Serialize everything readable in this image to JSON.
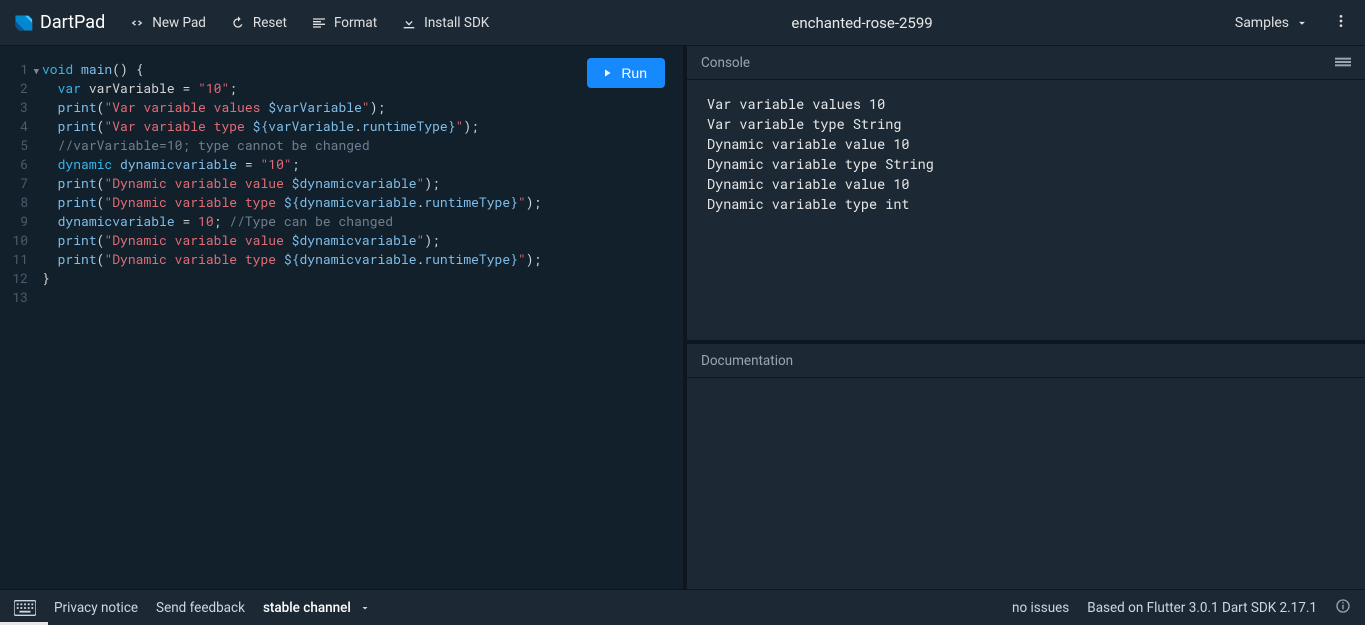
{
  "header": {
    "app_name": "DartPad",
    "project_title": "enchanted-rose-2599",
    "buttons": {
      "new_pad": "New Pad",
      "reset": "Reset",
      "format": "Format",
      "install_sdk": "Install SDK",
      "samples": "Samples",
      "run": "Run"
    }
  },
  "editor": {
    "line_count": 13,
    "fold_line": 1,
    "code_lines": [
      [
        [
          "kw",
          "void"
        ],
        [
          "pun",
          " "
        ],
        [
          "fn",
          "main"
        ],
        [
          "pun",
          "() {"
        ]
      ],
      [
        [
          "pun",
          "  "
        ],
        [
          "kw",
          "var"
        ],
        [
          "pun",
          " "
        ],
        [
          "id",
          "varVariable"
        ],
        [
          "pun",
          " = "
        ],
        [
          "str",
          "\"10\""
        ],
        [
          "pun",
          ";"
        ]
      ],
      [
        [
          "pun",
          "  "
        ],
        [
          "fn",
          "print"
        ],
        [
          "pun",
          "("
        ],
        [
          "str",
          "\"Var variable values "
        ],
        [
          "interp",
          "$varVariable"
        ],
        [
          "str",
          "\""
        ],
        [
          "pun",
          ");"
        ]
      ],
      [
        [
          "pun",
          "  "
        ],
        [
          "fn",
          "print"
        ],
        [
          "pun",
          "("
        ],
        [
          "str",
          "\"Var variable type "
        ],
        [
          "interp",
          "${"
        ],
        [
          "prop",
          "varVariable"
        ],
        [
          "pun",
          "."
        ],
        [
          "prop",
          "runtimeType"
        ],
        [
          "interp",
          "}"
        ],
        [
          "str",
          "\""
        ],
        [
          "pun",
          ");"
        ]
      ],
      [
        [
          "pun",
          "  "
        ],
        [
          "cmt",
          "//varVariable=10; type cannot be changed"
        ]
      ],
      [
        [
          "pun",
          "  "
        ],
        [
          "kw",
          "dynamic"
        ],
        [
          "pun",
          " "
        ],
        [
          "prop",
          "dynamicvariable"
        ],
        [
          "pun",
          " = "
        ],
        [
          "str",
          "\"10\""
        ],
        [
          "pun",
          ";"
        ]
      ],
      [
        [
          "pun",
          "  "
        ],
        [
          "fn",
          "print"
        ],
        [
          "pun",
          "("
        ],
        [
          "str",
          "\"Dynamic variable value "
        ],
        [
          "interp",
          "$dynamicvariable"
        ],
        [
          "str",
          "\""
        ],
        [
          "pun",
          ");"
        ]
      ],
      [
        [
          "pun",
          "  "
        ],
        [
          "fn",
          "print"
        ],
        [
          "pun",
          "("
        ],
        [
          "str",
          "\"Dynamic variable type "
        ],
        [
          "interp",
          "${"
        ],
        [
          "prop",
          "dynamicvariable"
        ],
        [
          "pun",
          "."
        ],
        [
          "prop",
          "runtimeType"
        ],
        [
          "interp",
          "}"
        ],
        [
          "str",
          "\""
        ],
        [
          "pun",
          ");"
        ]
      ],
      [
        [
          "pun",
          "  "
        ],
        [
          "prop",
          "dynamicvariable"
        ],
        [
          "pun",
          " = "
        ],
        [
          "num",
          "10"
        ],
        [
          "pun",
          "; "
        ],
        [
          "cmt",
          "//Type can be changed"
        ]
      ],
      [
        [
          "pun",
          "  "
        ],
        [
          "fn",
          "print"
        ],
        [
          "pun",
          "("
        ],
        [
          "str",
          "\"Dynamic variable value "
        ],
        [
          "interp",
          "$dynamicvariable"
        ],
        [
          "str",
          "\""
        ],
        [
          "pun",
          ");"
        ]
      ],
      [
        [
          "pun",
          "  "
        ],
        [
          "fn",
          "print"
        ],
        [
          "pun",
          "("
        ],
        [
          "str",
          "\"Dynamic variable type "
        ],
        [
          "interp",
          "${"
        ],
        [
          "prop",
          "dynamicvariable"
        ],
        [
          "pun",
          "."
        ],
        [
          "prop",
          "runtimeType"
        ],
        [
          "interp",
          "}"
        ],
        [
          "str",
          "\""
        ],
        [
          "pun",
          ");"
        ]
      ],
      [
        [
          "pun",
          "}"
        ]
      ],
      [
        [
          "pun",
          ""
        ]
      ]
    ]
  },
  "right": {
    "console_label": "Console",
    "documentation_label": "Documentation",
    "console_output": [
      "Var variable values 10",
      "Var variable type String",
      "Dynamic variable value 10",
      "Dynamic variable type String",
      "Dynamic variable value 10",
      "Dynamic variable type int"
    ]
  },
  "status": {
    "privacy": "Privacy notice",
    "feedback": "Send feedback",
    "channel": "stable channel",
    "issues": "no issues",
    "based_on": "Based on Flutter 3.0.1 Dart SDK 2.17.1"
  }
}
